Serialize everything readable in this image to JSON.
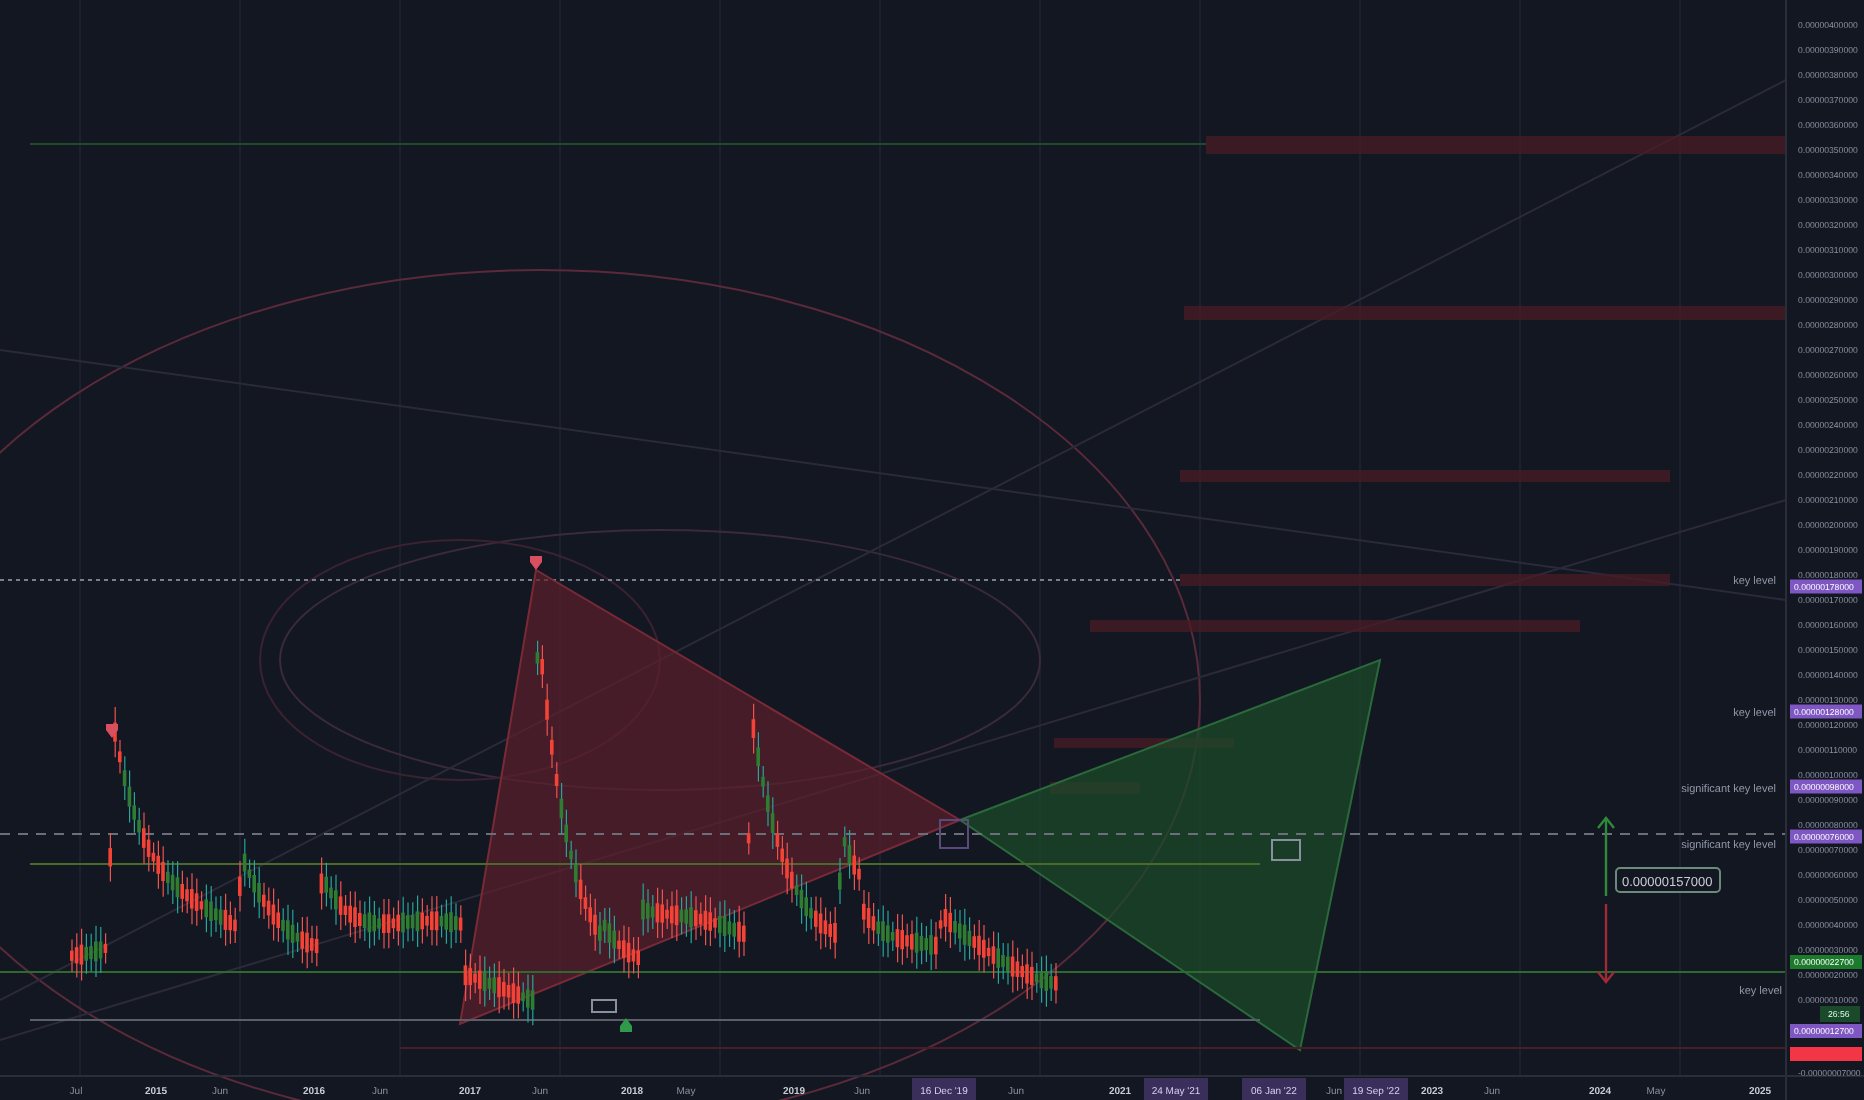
{
  "price_axis": {
    "ticks": [
      "0.00000400000",
      "0.00000390000",
      "0.00000380000",
      "0.00000370000",
      "0.00000360000",
      "0.00000350000",
      "0.00000340000",
      "0.00000330000",
      "0.00000320000",
      "0.00000310000",
      "0.00000300000",
      "0.00000290000",
      "0.00000280000",
      "0.00000270000",
      "0.00000260000",
      "0.00000250000",
      "0.00000240000",
      "0.00000230000",
      "0.00000220000",
      "0.00000210000",
      "0.00000200000",
      "0.00000190000",
      "0.00000180000",
      "0.00000170000",
      "0.00000160000",
      "0.00000150000",
      "0.00000140000",
      "0.00000130000",
      "0.00000120000",
      "0.00000110000",
      "0.00000100000",
      "0.00000090000",
      "0.00000080000",
      "0.00000070000",
      "0.00000060000",
      "0.00000050000",
      "0.00000040000",
      "0.00000030000",
      "0.00000020000",
      "0.00000010000"
    ],
    "bottom_label": "-0.00000007000",
    "badges": [
      {
        "text": "0.00000178000",
        "color": "#7e57c2"
      },
      {
        "text": "0.00000128000",
        "color": "#7e57c2"
      },
      {
        "text": "0.00000098000",
        "color": "#7e57c2"
      },
      {
        "text": "0.00000076000",
        "color": "#7e57c2"
      },
      {
        "text": "0.00000022700",
        "color": "#1b7a2b"
      },
      {
        "text": "0.00000012700",
        "color": "#7e57c2"
      },
      {
        "color": "#f23645"
      }
    ],
    "countdown": "26:56"
  },
  "time_axis": {
    "ticks": [
      "Jul",
      "2015",
      "Jun",
      "2016",
      "Jun",
      "2017",
      "Jun",
      "2018",
      "May",
      "2019",
      "Jun",
      "Jun",
      "2021",
      "Jun",
      "2023",
      "Jun",
      "2024",
      "May",
      "2025"
    ],
    "date_badges": [
      "16 Dec '19",
      "24 May '21",
      "06 Jan '22",
      "19 Sep '22"
    ]
  },
  "level_labels": [
    {
      "text": "key level"
    },
    {
      "text": "key level"
    },
    {
      "text": "significant key level"
    },
    {
      "text": "significant key level"
    },
    {
      "text": "key level"
    }
  ],
  "measure": {
    "text": "0.00000157000"
  }
}
